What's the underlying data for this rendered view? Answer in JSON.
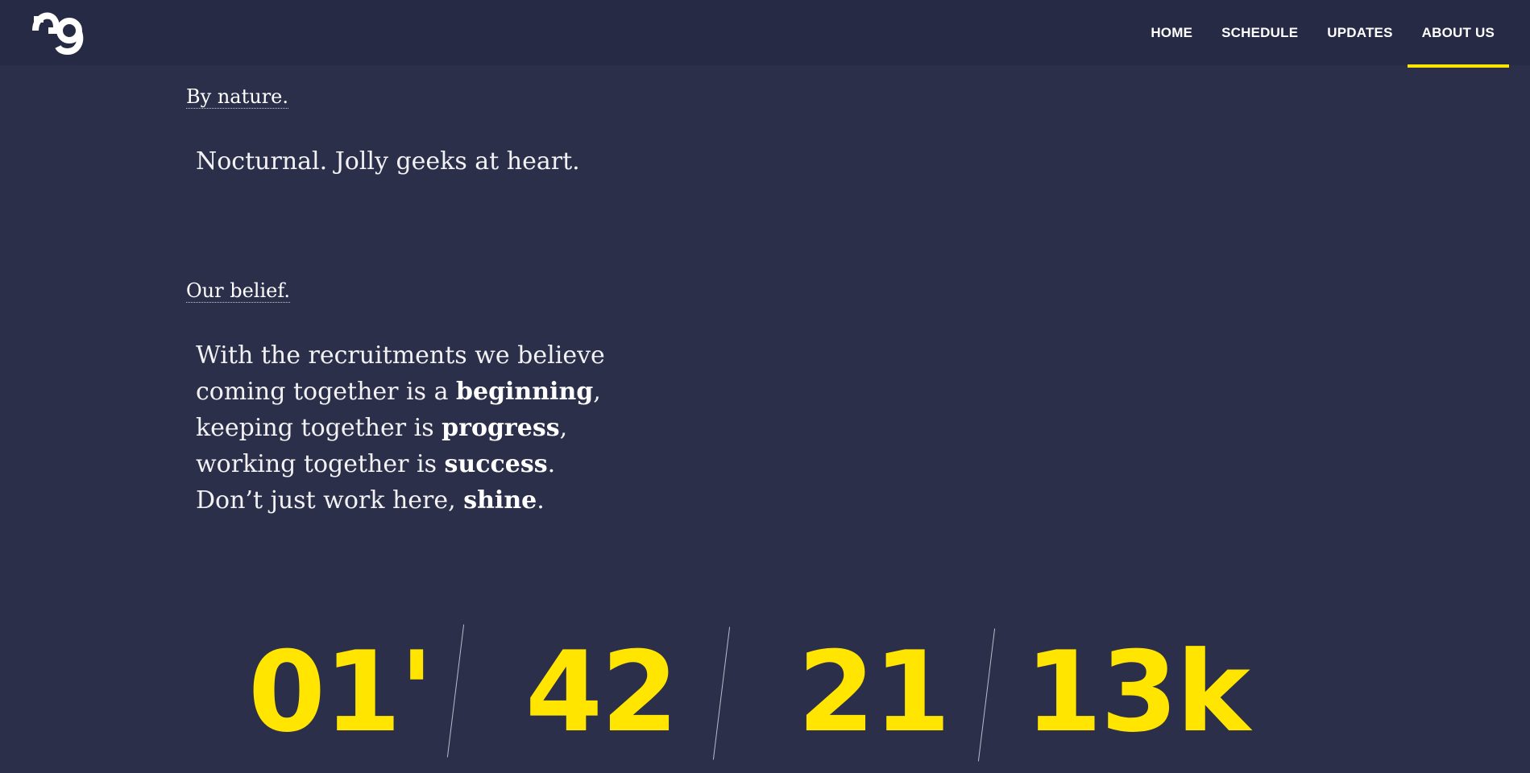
{
  "nav": {
    "items": [
      {
        "label": "HOME",
        "active": false
      },
      {
        "label": "SCHEDULE",
        "active": false
      },
      {
        "label": "UPDATES",
        "active": false
      },
      {
        "label": "ABOUT US",
        "active": true
      }
    ]
  },
  "logo": {
    "icon": "mg-logo-icon"
  },
  "sections": {
    "nature": {
      "label": "By nature.",
      "text": "Nocturnal. Jolly geeks at heart."
    },
    "belief": {
      "label": "Our belief.",
      "lines": [
        {
          "before": "With the recruitments we believe",
          "bold": "",
          "after": ""
        },
        {
          "before": "coming together is a ",
          "bold": "beginning",
          "after": ","
        },
        {
          "before": "keeping together is ",
          "bold": "progress",
          "after": ","
        },
        {
          "before": "working together is ",
          "bold": "success",
          "after": "."
        },
        {
          "before": "Don’t just work here, ",
          "bold": "shine",
          "after": "."
        }
      ]
    }
  },
  "stats": [
    "01'",
    "42",
    "21",
    "13k"
  ],
  "colors": {
    "background": "#2b2f4a",
    "header": "#262a44",
    "accent": "#ffe500"
  }
}
